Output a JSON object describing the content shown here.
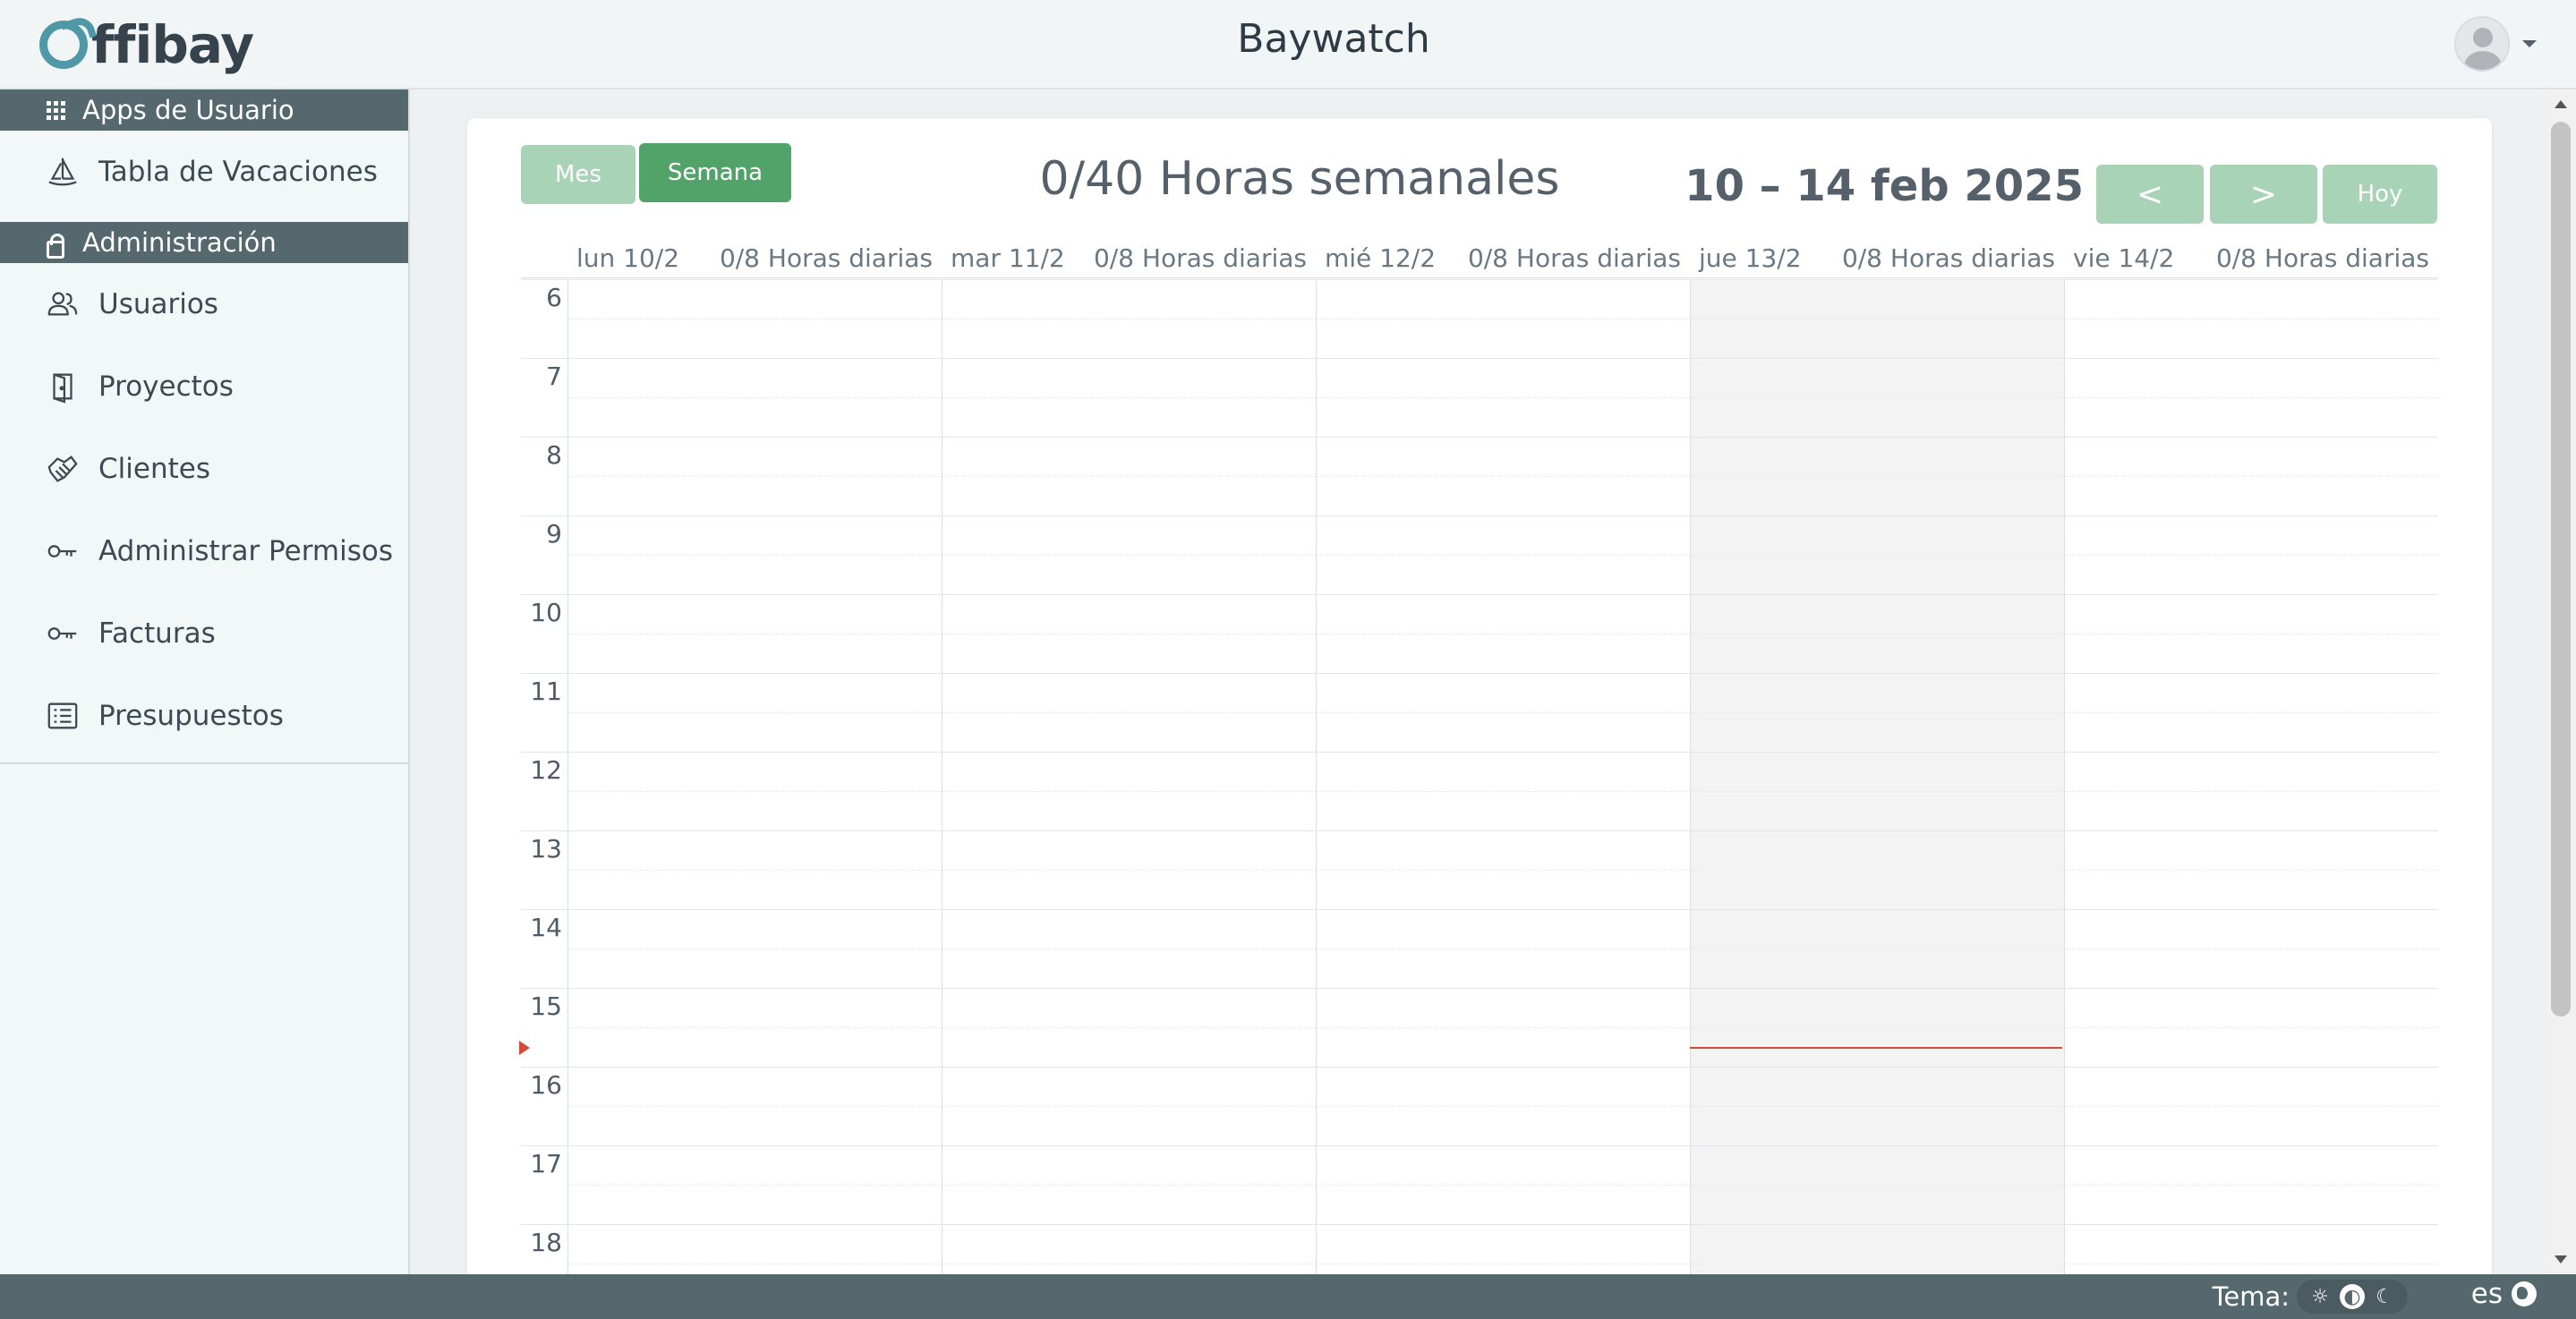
{
  "brand": {
    "logo_text": "ffibay",
    "logo_letter": "O"
  },
  "header": {
    "title": "Baywatch"
  },
  "sidebar": {
    "sections": [
      {
        "label": "Apps de Usuario",
        "items": [
          {
            "label": "Tabla de Vacaciones",
            "icon": "sailboat-icon"
          }
        ]
      },
      {
        "label": "Administración",
        "items": [
          {
            "label": "Usuarios",
            "icon": "users-icon"
          },
          {
            "label": "Proyectos",
            "icon": "door-icon"
          },
          {
            "label": "Clientes",
            "icon": "handshake-icon"
          },
          {
            "label": "Administrar Permisos",
            "icon": "key-icon"
          },
          {
            "label": "Facturas",
            "icon": "key-icon"
          },
          {
            "label": "Presupuestos",
            "icon": "list-icon"
          }
        ]
      }
    ]
  },
  "calendar": {
    "view_buttons": {
      "month": "Mes",
      "week": "Semana",
      "active": "week"
    },
    "weekly_hours": "0/40 Horas semanales",
    "range": "10 – 14 feb 2025",
    "nav": {
      "prev": "<",
      "next": ">",
      "today": "Hoy"
    },
    "days": [
      {
        "name": "lun 10/2",
        "hours": "0/8 Horas diarias",
        "today": false
      },
      {
        "name": "mar 11/2",
        "hours": "0/8 Horas diarias",
        "today": false
      },
      {
        "name": "mié 12/2",
        "hours": "0/8 Horas diarias",
        "today": false
      },
      {
        "name": "jue 13/2",
        "hours": "0/8 Horas diarias",
        "today": true
      },
      {
        "name": "vie 14/2",
        "hours": "0/8 Horas diarias",
        "today": false
      }
    ],
    "hours": [
      "6",
      "7",
      "8",
      "9",
      "10",
      "11",
      "12",
      "13",
      "14",
      "15",
      "16",
      "17",
      "18"
    ],
    "now_time_hours": 15.75
  },
  "footer": {
    "theme_label": "Tema:",
    "theme_options": [
      "light",
      "system",
      "dark"
    ],
    "active_theme": "system",
    "language": "es"
  },
  "colors": {
    "accent_green": "#52a36a",
    "accent_green_light": "#a9d3b7",
    "sidebar_header": "#55686e",
    "now_indicator": "#d64a3c"
  }
}
